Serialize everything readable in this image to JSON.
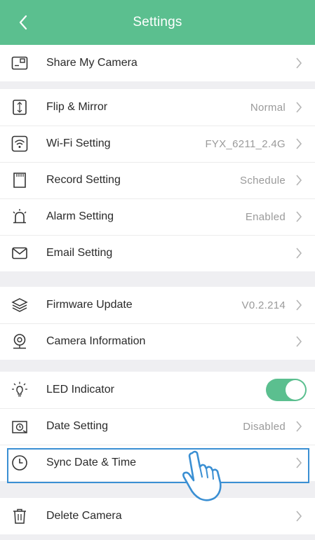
{
  "header": {
    "title": "Settings"
  },
  "sections": [
    {
      "items": [
        {
          "icon": "share-camera-icon",
          "label": "Share My Camera",
          "value": ""
        }
      ]
    },
    {
      "items": [
        {
          "icon": "flip-mirror-icon",
          "label": "Flip & Mirror",
          "value": "Normal"
        },
        {
          "icon": "wifi-icon",
          "label": "Wi-Fi Setting",
          "value": "FYX_6211_2.4G"
        },
        {
          "icon": "sd-card-icon",
          "label": "Record Setting",
          "value": "Schedule"
        },
        {
          "icon": "alarm-icon",
          "label": "Alarm Setting",
          "value": "Enabled"
        },
        {
          "icon": "email-icon",
          "label": "Email Setting",
          "value": ""
        }
      ]
    },
    {
      "items": [
        {
          "icon": "layers-icon",
          "label": "Firmware Update",
          "value": "V0.2.214"
        },
        {
          "icon": "camera-info-icon",
          "label": "Camera Information",
          "value": ""
        }
      ]
    },
    {
      "items": [
        {
          "icon": "led-bulb-icon",
          "label": "LED Indicator",
          "toggle": true
        },
        {
          "icon": "date-setting-icon",
          "label": "Date Setting",
          "value": "Disabled"
        },
        {
          "icon": "clock-icon",
          "label": "Sync Date & Time",
          "value": ""
        }
      ]
    },
    {
      "items": [
        {
          "icon": "trash-icon",
          "label": "Delete Camera",
          "value": ""
        }
      ]
    }
  ],
  "colors": {
    "accent": "#5bbf8f",
    "highlight": "#3a8fd3",
    "background": "#efeff2"
  }
}
